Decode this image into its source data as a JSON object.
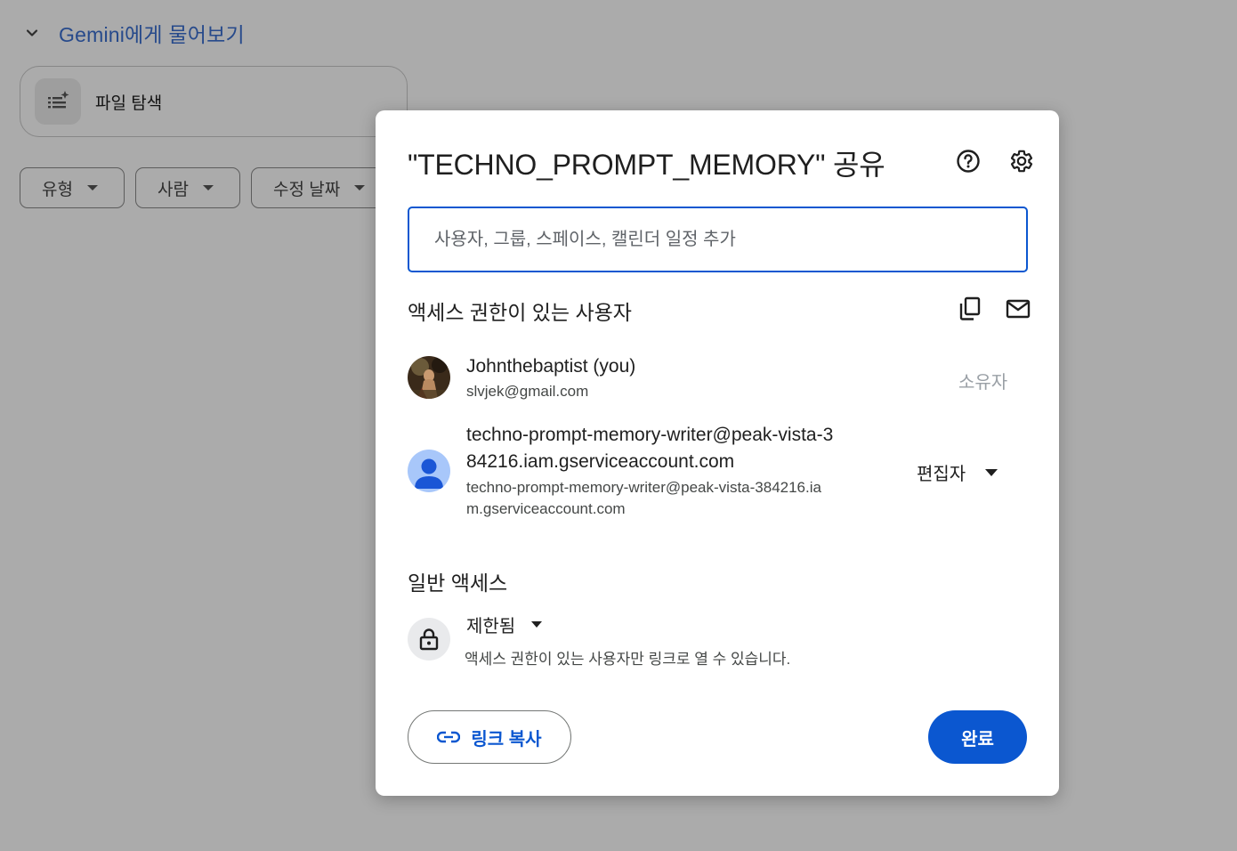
{
  "background": {
    "gemini_label": "Gemini에게 물어보기",
    "file_search_label": "파일 탐색",
    "filters": [
      "유형",
      "사람",
      "수정 날짜"
    ]
  },
  "dialog": {
    "title": "\"TECHNO_PROMPT_MEMORY\" 공유",
    "add_placeholder": "사용자, 그룹, 스페이스, 캘린더 일정 추가",
    "people_section_title": "액세스 권한이 있는 사용자",
    "people": [
      {
        "name": "Johnthebaptist (you)",
        "email": "slvjek@gmail.com",
        "role": "소유자"
      },
      {
        "name_line1": "techno-prompt-memory-writer@peak-vista-3",
        "name_line2": "84216.iam.gserviceaccount.com",
        "email_line1": "techno-prompt-memory-writer@peak-vista-384216.ia",
        "email_line2": "m.gserviceaccount.com",
        "role": "편집자"
      }
    ],
    "general_access_title": "일반 액세스",
    "access_level": "제한됨",
    "access_description": "액세스 권한이 있는 사용자만 링크로 열 수 있습니다.",
    "copy_link_label": "링크 복사",
    "done_label": "완료"
  },
  "colors": {
    "accent": "#0b57d0",
    "scrim": "rgba(0,0,0,0.33)"
  }
}
